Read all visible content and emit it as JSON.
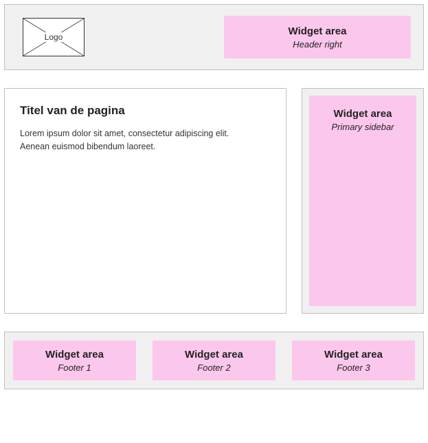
{
  "header": {
    "logo_label": "Logo",
    "widget": {
      "title": "Widget area",
      "subtitle": "Header right"
    }
  },
  "content": {
    "title": "Titel van de pagina",
    "body": "Lorem ipsum dolor sit amet, consectetur adipiscing elit. Aenean euismod bibendum laoreet."
  },
  "sidebar": {
    "widget": {
      "title": "Widget area",
      "subtitle": "Primary sidebar"
    }
  },
  "footer": {
    "widgets": [
      {
        "title": "Widget area",
        "subtitle": "Footer 1"
      },
      {
        "title": "Widget area",
        "subtitle": "Footer 2"
      },
      {
        "title": "Widget area",
        "subtitle": "Footer 3"
      }
    ]
  }
}
